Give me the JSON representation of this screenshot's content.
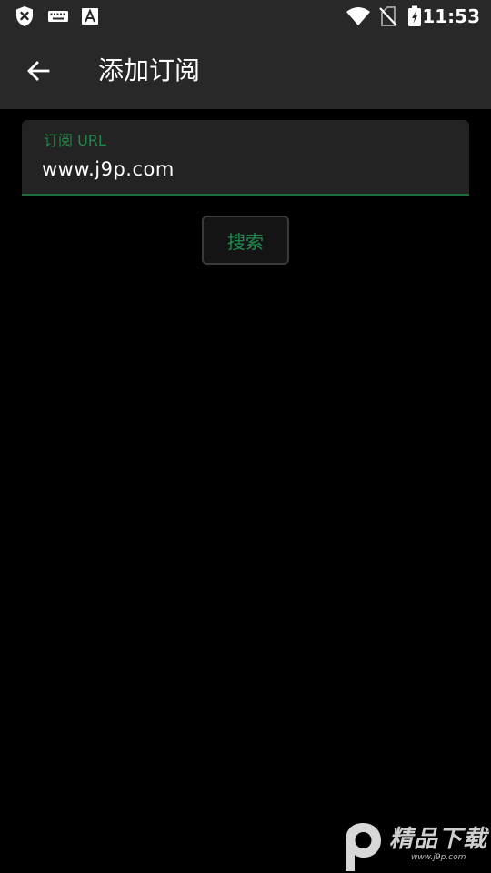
{
  "status_bar": {
    "time": "11:53",
    "icons": [
      "shield-x-icon",
      "keyboard-icon",
      "font-a-icon",
      "wifi-icon",
      "no-sim-icon",
      "battery-charging-icon"
    ]
  },
  "app_bar": {
    "title": "添加订阅",
    "back_icon": "arrow-left-icon"
  },
  "form": {
    "url_label": "订阅 URL",
    "url_value": "www.j9p.com",
    "search_label": "搜索"
  },
  "watermark": {
    "text": "精品下载",
    "subtext": "www.j9p.com"
  },
  "colors": {
    "bar_bg": "#282828",
    "accent": "#1f8a4c",
    "field_bg": "#232323",
    "page_bg": "#000000"
  }
}
